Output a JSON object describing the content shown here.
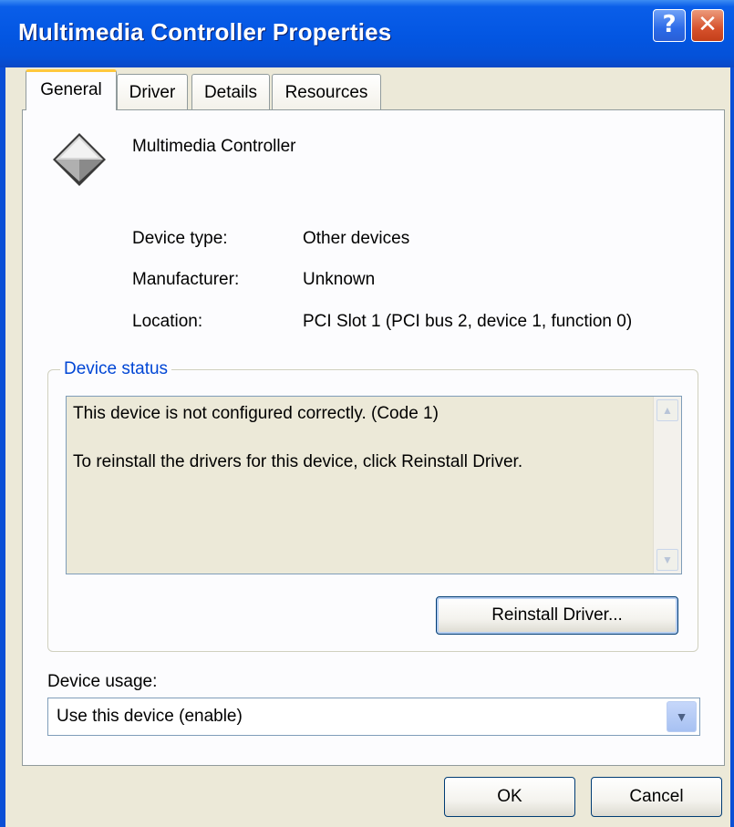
{
  "window": {
    "title": "Multimedia Controller Properties",
    "help_glyph": "?",
    "close_glyph": "✕"
  },
  "tabs": [
    {
      "label": "General",
      "active": true
    },
    {
      "label": "Driver",
      "active": false
    },
    {
      "label": "Details",
      "active": false
    },
    {
      "label": "Resources",
      "active": false
    }
  ],
  "device": {
    "name": "Multimedia Controller",
    "icon": "generic-device-icon",
    "properties": [
      {
        "label": "Device type:",
        "value": "Other devices"
      },
      {
        "label": "Manufacturer:",
        "value": "Unknown"
      },
      {
        "label": "Location:",
        "value": "PCI Slot 1 (PCI bus 2, device 1, function 0)"
      }
    ]
  },
  "device_status": {
    "legend": "Device status",
    "lines": [
      "This device is not configured correctly. (Code 1)",
      "To reinstall the drivers for this device, click Reinstall Driver."
    ],
    "reinstall_button": "Reinstall Driver..."
  },
  "device_usage": {
    "label": "Device usage:",
    "selected": "Use this device (enable)"
  },
  "footer": {
    "ok_label": "OK",
    "cancel_label": "Cancel"
  },
  "colors": {
    "title_bar": "#0356e2",
    "dialog_bg": "#ece9d8",
    "legend_blue": "#0046d5",
    "active_tab_accent": "#ffc83c"
  }
}
